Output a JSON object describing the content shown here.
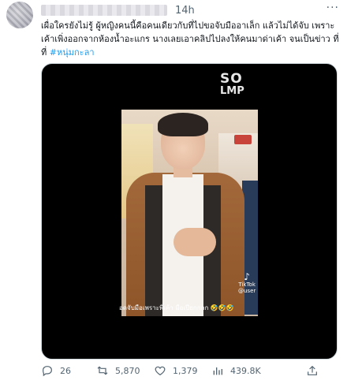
{
  "tweet": {
    "time": "14h",
    "more": "···",
    "text": "เผื่อใครยังไม่รู้ ผู้หญิงคนนี้คือคนเดียวกับที่ไปขอจับมืออาเล็ก แล้วไม่ได้จับ เพราะเค้าเพิ่งออกจากห้องน้ำอะแกร นางเลยเอาคลิปไปลงให้คนมาด่าเค้า จนเป็นข่าว ที่ที่",
    "hashtag": "#หนุ่มกะลา"
  },
  "media": {
    "logo_line1": "SO",
    "logo_line2": "LMP",
    "tiktok_label": "TikTok",
    "tiktok_handle": "@user",
    "caption": "อดจับมือเพราะพี่เค้า มือเปียกกกก 🤣🤣🤣"
  },
  "actions": {
    "replies": "26",
    "retweets": "5,870",
    "likes": "1,379",
    "views": "439.8K"
  }
}
